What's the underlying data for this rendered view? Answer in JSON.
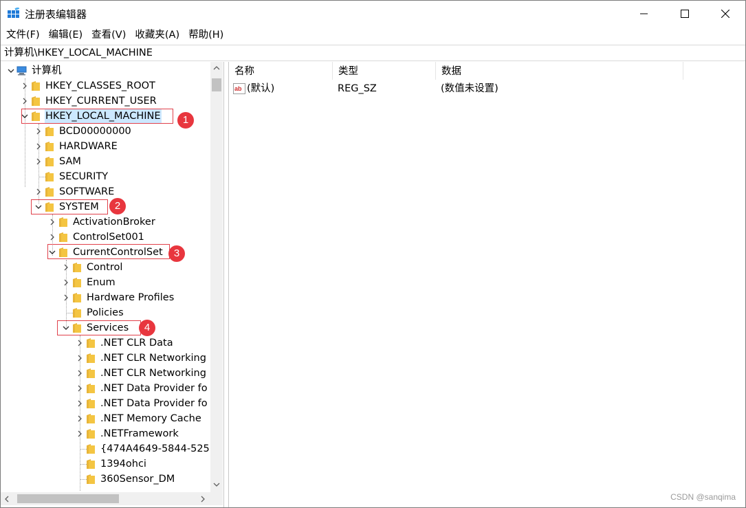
{
  "window": {
    "title": "注册表编辑器"
  },
  "menu": [
    "文件(F)",
    "编辑(E)",
    "查看(V)",
    "收藏夹(A)",
    "帮助(H)"
  ],
  "address": "计算机\\HKEY_LOCAL_MACHINE",
  "tree": {
    "root": "计算机",
    "hives": [
      "HKEY_CLASSES_ROOT",
      "HKEY_CURRENT_USER",
      "HKEY_LOCAL_MACHINE"
    ],
    "hklm_children": [
      "BCD00000000",
      "HARDWARE",
      "SAM",
      "SECURITY",
      "SOFTWARE",
      "SYSTEM"
    ],
    "system_children": [
      "ActivationBroker",
      "ControlSet001",
      "CurrentControlSet"
    ],
    "ccs_children": [
      "Control",
      "Enum",
      "Hardware Profiles",
      "Policies",
      "Services"
    ],
    "services_children": [
      ".NET CLR Data",
      ".NET CLR Networking",
      ".NET CLR Networking",
      ".NET Data Provider fo",
      ".NET Data Provider fo",
      ".NET Memory Cache",
      ".NETFramework",
      "{474A4649-5844-525",
      "1394ohci",
      "360Sensor_DM"
    ]
  },
  "annotations": [
    "1",
    "2",
    "3",
    "4"
  ],
  "list": {
    "columns": [
      "名称",
      "类型",
      "数据"
    ],
    "rows": [
      {
        "name": "(默认)",
        "type": "REG_SZ",
        "data": "(数值未设置)"
      }
    ]
  },
  "watermark": "CSDN @sanqima",
  "colors": {
    "selection": "#cce8ff",
    "annotation_red": "#e8363e",
    "folder_yellow": "#f4c542"
  }
}
